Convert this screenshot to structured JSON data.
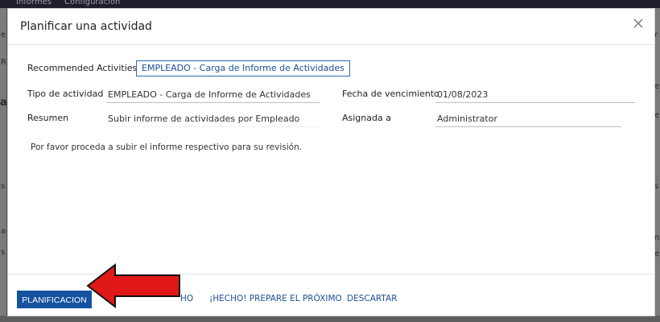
{
  "background": {
    "topbar_items": [
      "Informes",
      "Configuración"
    ],
    "fragments": [
      "e",
      "R",
      "a",
      "s",
      "a",
      "s",
      "r",
      "e",
      "e",
      "s",
      "n",
      "e"
    ]
  },
  "modal": {
    "title": "Planificar una actividad",
    "close_icon": "close-icon"
  },
  "form": {
    "recommended_label": "Recommended Activities",
    "recommended_value": "EMPLEADO - Carga de Informe de Actividades",
    "activity_type_label": "Tipo de actividad",
    "activity_type_value": "EMPLEADO - Carga de Informe de Actividades",
    "due_date_label": "Fecha de vencimiento",
    "due_date_value": "01/08/2023",
    "summary_label": "Resumen",
    "summary_value": "Subir informe de actividades por Empleado",
    "assigned_label": "Asignada a",
    "assigned_value": "Administrator",
    "note": "Por favor proceda a subir el informe respectivo para su revisión."
  },
  "footer": {
    "primary_button": "PLANIFICACION",
    "done_button_partial": "HO",
    "done_prepare_next": "¡HECHO! PREPARE EL PRÓXIMO",
    "discard": "DESCARTAR"
  },
  "colors": {
    "primary": "#1552a0",
    "link": "#1f4f95",
    "annotation_arrow": "#e11818"
  }
}
